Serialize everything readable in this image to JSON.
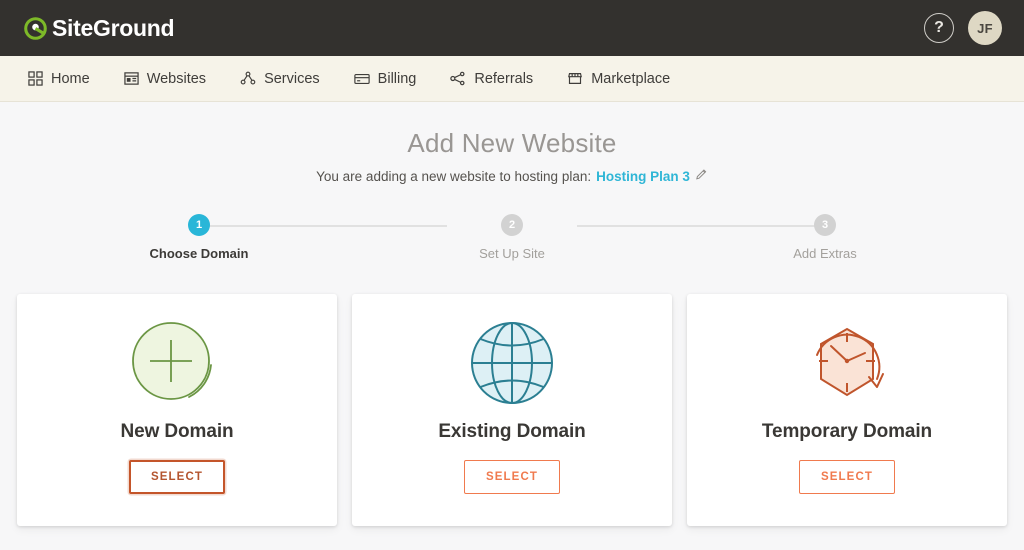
{
  "header": {
    "brand_name": "SiteGround",
    "brand_icon": "siteground-logo-icon",
    "help_icon": "question-mark-icon",
    "help_label": "?",
    "avatar_initials": "JF"
  },
  "nav": {
    "items": [
      {
        "label": "Home",
        "icon": "grid-squares-icon"
      },
      {
        "label": "Websites",
        "icon": "browser-window-icon"
      },
      {
        "label": "Services",
        "icon": "nodes-network-icon"
      },
      {
        "label": "Billing",
        "icon": "credit-card-icon"
      },
      {
        "label": "Referrals",
        "icon": "share-network-icon"
      },
      {
        "label": "Marketplace",
        "icon": "storefront-icon"
      }
    ]
  },
  "page": {
    "title": "Add New Website",
    "subtitle_prefix": "You are adding a new website to hosting plan:",
    "plan_name": "Hosting Plan 3",
    "edit_icon": "pencil-edit-icon"
  },
  "stepper": {
    "steps": [
      {
        "number": "1",
        "label": "Choose Domain",
        "state": "active"
      },
      {
        "number": "2",
        "label": "Set Up Site",
        "state": "inactive"
      },
      {
        "number": "3",
        "label": "Add Extras",
        "state": "inactive"
      }
    ]
  },
  "cards": [
    {
      "title": "New Domain",
      "icon": "plus-circle-green-icon",
      "button_label": "SELECT",
      "button_state": "focused"
    },
    {
      "title": "Existing Domain",
      "icon": "globe-teal-icon",
      "button_label": "SELECT",
      "button_state": "default"
    },
    {
      "title": "Temporary Domain",
      "icon": "hexagon-clock-orange-icon",
      "button_label": "SELECT",
      "button_state": "default"
    }
  ],
  "colors": {
    "header_bg": "#33312e",
    "nav_bg": "#f6f3e9",
    "page_bg": "#f7f7f8",
    "accent_cyan": "#2fb6d6",
    "accent_orange": "#f07a4e",
    "accent_orange_dark": "#c4552a",
    "icon_green": "#6b9644",
    "icon_green_fill": "#eef5e0",
    "icon_teal": "#2b7f92",
    "icon_teal_fill": "#ddf0f5",
    "avatar_bg": "#ded8c4"
  }
}
